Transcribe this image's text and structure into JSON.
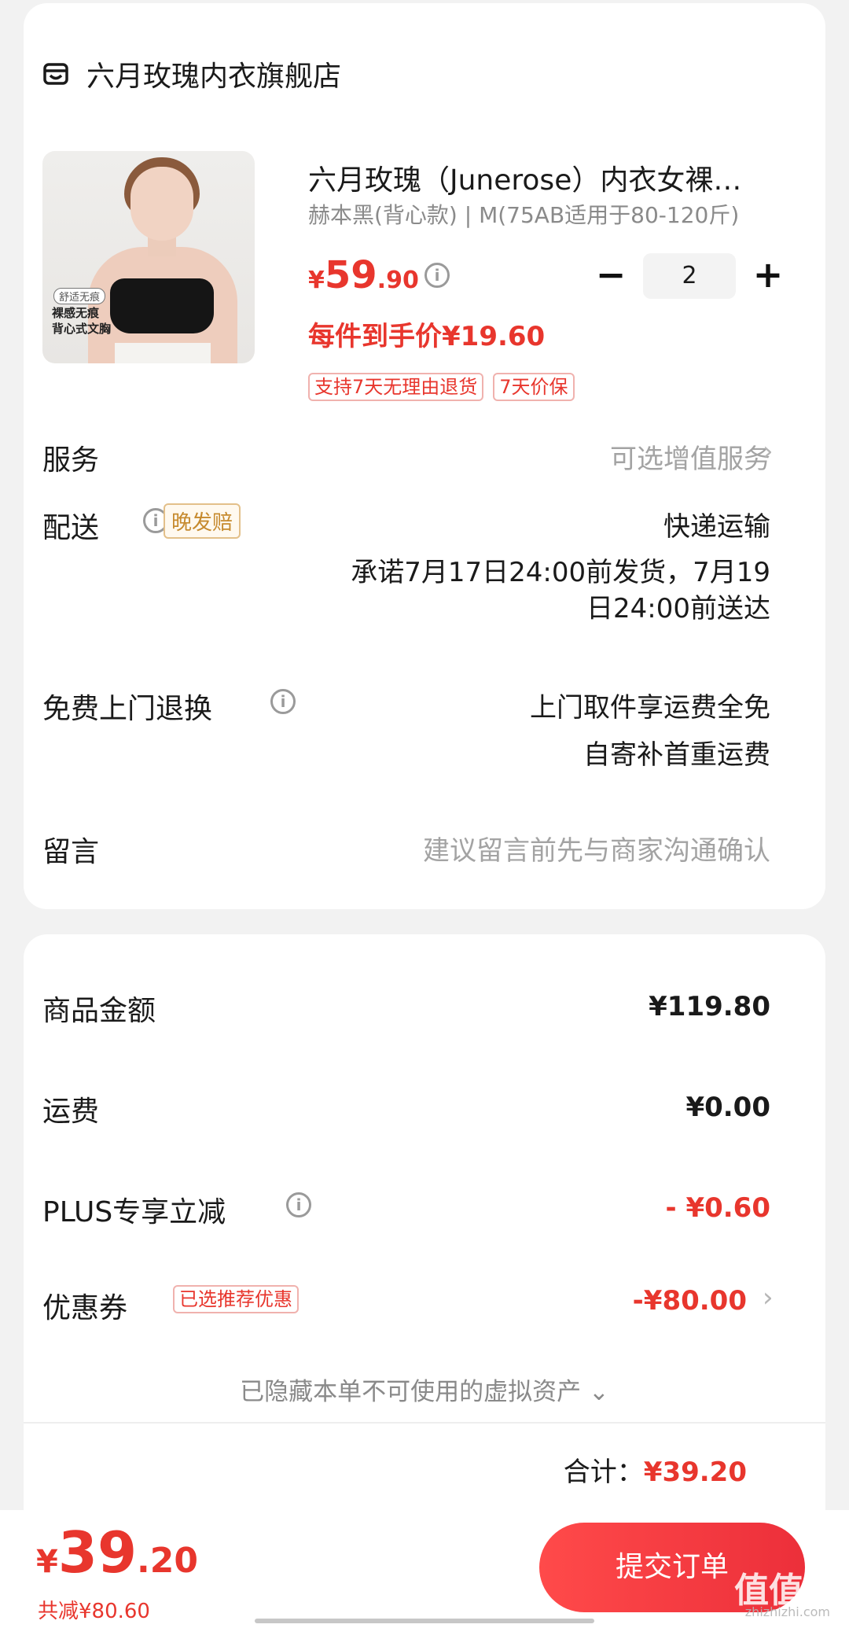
{
  "shop": {
    "name": "六月玫瑰内衣旗舰店"
  },
  "product": {
    "image_tags": [
      "舒适无痕",
      "裸感无痕\n背心式文胸"
    ],
    "title": "六月玫瑰（Junerose）内衣女裸…",
    "spec": "赫本黑(背心款) | M(75AB适用于80-120斤)",
    "price_currency": "¥",
    "price_int": "59",
    "price_dec": ".90",
    "quantity": "2",
    "minus": "−",
    "plus": "+",
    "unit_price": "每件到手价¥19.60",
    "tags": [
      "支持7天无理由退货",
      "7天价保"
    ]
  },
  "service": {
    "label": "服务",
    "value": "可选增值服务"
  },
  "delivery": {
    "label": "配送",
    "badge": "晚发赔",
    "method": "快递运输",
    "promise_line1": "承诺7月17日24:00前发货，7月19",
    "promise_line2": "日24:00前送达"
  },
  "return": {
    "label": "免费上门退换",
    "line1": "上门取件享运费全免",
    "line2": "自寄补首重运费"
  },
  "message": {
    "label": "留言",
    "placeholder": "建议留言前先与商家沟通确认"
  },
  "summary": {
    "goods_label": "商品金额",
    "goods_value": "¥119.80",
    "shipping_label": "运费",
    "shipping_value": "¥0.00",
    "plus_label": "PLUS专享立减",
    "plus_value": "- ¥0.60",
    "coupon_label": "优惠券",
    "coupon_badge": "已选推荐优惠",
    "coupon_value": "-¥80.00",
    "hidden_note": "已隐藏本单不可使用的虚拟资产 ⌄",
    "total_label": "合计：",
    "total_value": "¥39.20"
  },
  "bottom": {
    "currency": "¥",
    "int": "39",
    "dec": ".20",
    "saved": "共减¥80.60",
    "submit": "提交订单"
  },
  "watermark": {
    "main": "值值值",
    "sub": "zhizhizhi.com"
  },
  "colors": {
    "accent": "#e8362d",
    "muted": "#a3a3a3"
  }
}
